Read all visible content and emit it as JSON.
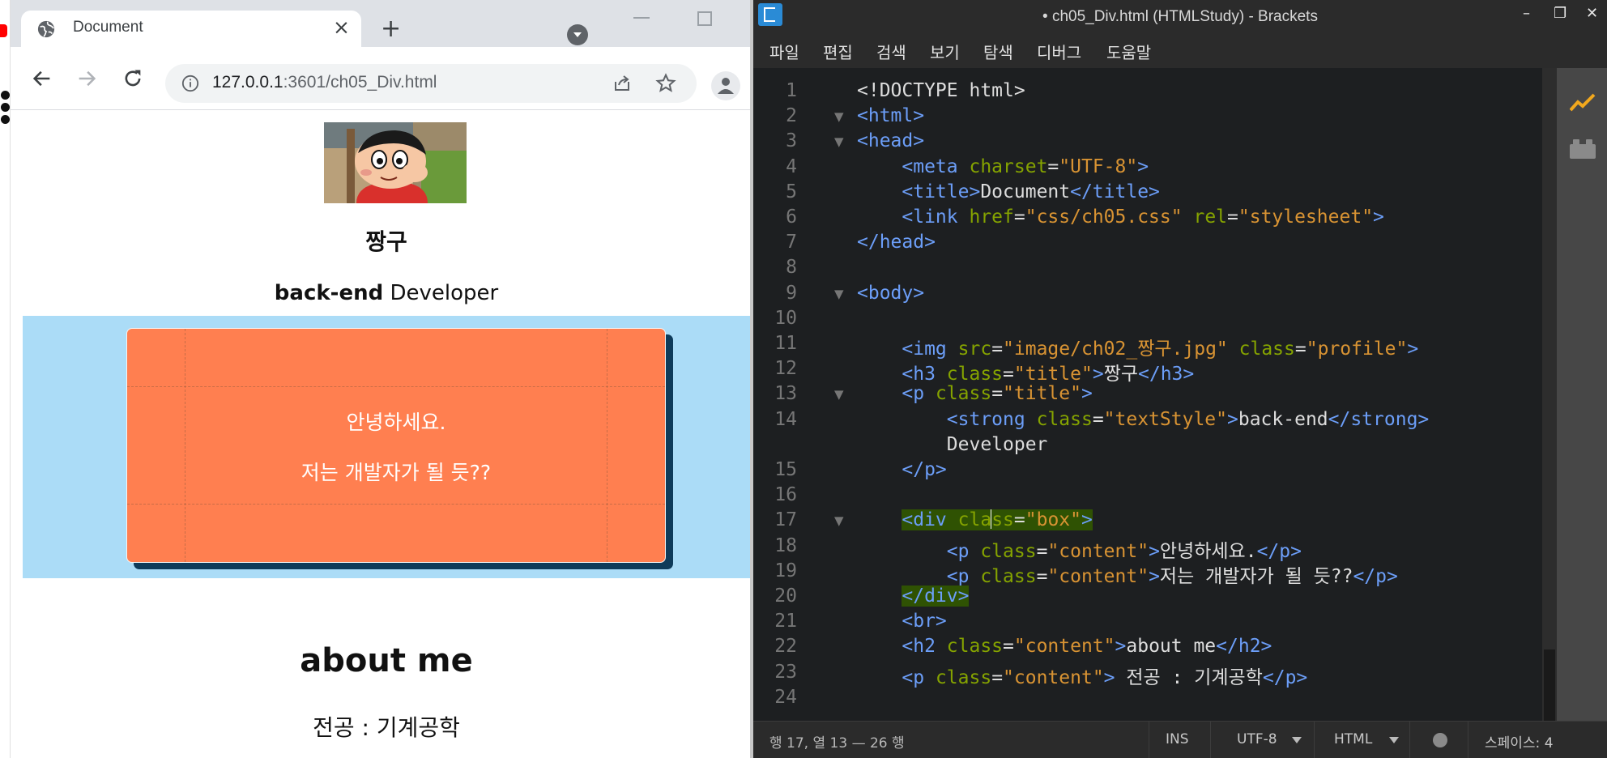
{
  "browser": {
    "tab_title": "Document",
    "tab_close": "×",
    "new_tab": "+",
    "url_host": "127.0.0.1",
    "url_rest": ":3601/ch05_Div.html"
  },
  "page": {
    "name": "짱구",
    "role_strong": "back-end",
    "role_rest": " Developer",
    "box_lines": [
      "안녕하세요.",
      "저는 개발자가 될 듯??"
    ],
    "about_title": "about me",
    "major": "전공 : 기계공학",
    "colors": {
      "box": "#ff7f50",
      "band": "#abdcf7",
      "box_shadow": "#0e3b5a"
    }
  },
  "editor": {
    "window_title": "• ch05_Div.html (HTMLStudy) - Brackets",
    "menu": [
      "파일",
      "편집",
      "검색",
      "보기",
      "탐색",
      "디버그",
      "도움말"
    ],
    "lines": [
      {
        "n": "1",
        "fold": "",
        "t": [
          [
            "txt",
            "<!DOCTYPE html>"
          ]
        ]
      },
      {
        "n": "2",
        "fold": "▼",
        "t": [
          [
            "tag",
            "<html>"
          ]
        ]
      },
      {
        "n": "3",
        "fold": "▼",
        "t": [
          [
            "tag",
            "<head>"
          ]
        ]
      },
      {
        "n": "4",
        "fold": "",
        "t": [
          [
            "txt",
            "    "
          ],
          [
            "tag",
            "<meta "
          ],
          [
            "attr",
            "charset"
          ],
          [
            "txt",
            "="
          ],
          [
            "val",
            "\"UTF-8\""
          ],
          [
            "tag",
            ">"
          ]
        ]
      },
      {
        "n": "5",
        "fold": "",
        "t": [
          [
            "txt",
            "    "
          ],
          [
            "tag",
            "<title>"
          ],
          [
            "txt",
            "Document"
          ],
          [
            "tag",
            "</title>"
          ]
        ]
      },
      {
        "n": "6",
        "fold": "",
        "t": [
          [
            "txt",
            "    "
          ],
          [
            "tag",
            "<link "
          ],
          [
            "attr",
            "href"
          ],
          [
            "txt",
            "="
          ],
          [
            "val",
            "\"css/ch05.css\""
          ],
          [
            "txt",
            " "
          ],
          [
            "attr",
            "rel"
          ],
          [
            "txt",
            "="
          ],
          [
            "val",
            "\"stylesheet\""
          ],
          [
            "tag",
            ">"
          ]
        ]
      },
      {
        "n": "7",
        "fold": "",
        "t": [
          [
            "tag",
            "</head>"
          ]
        ]
      },
      {
        "n": "8",
        "fold": "",
        "t": []
      },
      {
        "n": "9",
        "fold": "▼",
        "t": [
          [
            "tag",
            "<body>"
          ]
        ]
      },
      {
        "n": "10",
        "fold": "",
        "t": []
      },
      {
        "n": "11",
        "fold": "",
        "t": [
          [
            "txt",
            "    "
          ],
          [
            "tag",
            "<img "
          ],
          [
            "attr",
            "src"
          ],
          [
            "txt",
            "="
          ],
          [
            "val",
            "\"image/ch02_짱구.jpg\""
          ],
          [
            "txt",
            " "
          ],
          [
            "attr",
            "class"
          ],
          [
            "txt",
            "="
          ],
          [
            "val",
            "\"profile\""
          ],
          [
            "tag",
            ">"
          ]
        ]
      },
      {
        "n": "12",
        "fold": "",
        "t": [
          [
            "txt",
            "    "
          ],
          [
            "tag",
            "<h3 "
          ],
          [
            "attr",
            "class"
          ],
          [
            "txt",
            "="
          ],
          [
            "val",
            "\"title\""
          ],
          [
            "tag",
            ">"
          ],
          [
            "txt",
            "짱구"
          ],
          [
            "tag",
            "</h3>"
          ]
        ]
      },
      {
        "n": "13",
        "fold": "▼",
        "t": [
          [
            "txt",
            "    "
          ],
          [
            "tag",
            "<p "
          ],
          [
            "attr",
            "class"
          ],
          [
            "txt",
            "="
          ],
          [
            "val",
            "\"title\""
          ],
          [
            "tag",
            ">"
          ]
        ]
      },
      {
        "n": "14",
        "fold": "",
        "t": [
          [
            "txt",
            "        "
          ],
          [
            "tag",
            "<strong "
          ],
          [
            "attr",
            "class"
          ],
          [
            "txt",
            "="
          ],
          [
            "val",
            "\"textStyle\""
          ],
          [
            "tag",
            ">"
          ],
          [
            "txt",
            "back-end"
          ],
          [
            "tag",
            "</strong>"
          ]
        ]
      },
      {
        "n": "",
        "fold": "",
        "t": [
          [
            "txt",
            "        Developer"
          ]
        ]
      },
      {
        "n": "15",
        "fold": "",
        "t": [
          [
            "txt",
            "    "
          ],
          [
            "tag",
            "</p>"
          ]
        ]
      },
      {
        "n": "16",
        "fold": "",
        "t": []
      },
      {
        "n": "17",
        "fold": "▼",
        "t": [
          [
            "txt",
            "    "
          ],
          [
            "tag hl",
            "<div "
          ],
          [
            "attr hl",
            "cla"
          ],
          [
            "caret",
            ""
          ],
          [
            "attr hl",
            "ss"
          ],
          [
            "txt hl",
            "="
          ],
          [
            "val hl",
            "\"box\""
          ],
          [
            "tag hl",
            ">"
          ]
        ]
      },
      {
        "n": "18",
        "fold": "",
        "t": [
          [
            "txt",
            "        "
          ],
          [
            "tag",
            "<p "
          ],
          [
            "attr",
            "class"
          ],
          [
            "txt",
            "="
          ],
          [
            "val",
            "\"content\""
          ],
          [
            "tag",
            ">"
          ],
          [
            "txt",
            "안녕하세요."
          ],
          [
            "tag",
            "</p>"
          ]
        ]
      },
      {
        "n": "19",
        "fold": "",
        "t": [
          [
            "txt",
            "        "
          ],
          [
            "tag",
            "<p "
          ],
          [
            "attr",
            "class"
          ],
          [
            "txt",
            "="
          ],
          [
            "val",
            "\"content\""
          ],
          [
            "tag",
            ">"
          ],
          [
            "txt",
            "저는 개발자가 될 듯??"
          ],
          [
            "tag",
            "</p>"
          ]
        ]
      },
      {
        "n": "20",
        "fold": "",
        "t": [
          [
            "txt",
            "    "
          ],
          [
            "tag hl",
            "</div>"
          ]
        ]
      },
      {
        "n": "21",
        "fold": "",
        "t": [
          [
            "txt",
            "    "
          ],
          [
            "tag",
            "<br>"
          ]
        ]
      },
      {
        "n": "22",
        "fold": "",
        "t": [
          [
            "txt",
            "    "
          ],
          [
            "tag",
            "<h2 "
          ],
          [
            "attr",
            "class"
          ],
          [
            "txt",
            "="
          ],
          [
            "val",
            "\"content\""
          ],
          [
            "tag",
            ">"
          ],
          [
            "txt",
            "about me"
          ],
          [
            "tag",
            "</h2>"
          ]
        ]
      },
      {
        "n": "23",
        "fold": "",
        "t": [
          [
            "txt",
            "    "
          ],
          [
            "tag",
            "<p "
          ],
          [
            "attr",
            "class"
          ],
          [
            "txt",
            "="
          ],
          [
            "val",
            "\"content\""
          ],
          [
            "tag",
            ">"
          ],
          [
            "txt",
            " 전공 : 기계공학"
          ],
          [
            "tag",
            "</p>"
          ]
        ]
      },
      {
        "n": "24",
        "fold": "",
        "t": []
      }
    ],
    "status": {
      "cursor": "행 17, 열 13 — 26 행",
      "mode": "INS",
      "encoding": "UTF-8",
      "language": "HTML",
      "indent": "스페이스: 4"
    }
  }
}
